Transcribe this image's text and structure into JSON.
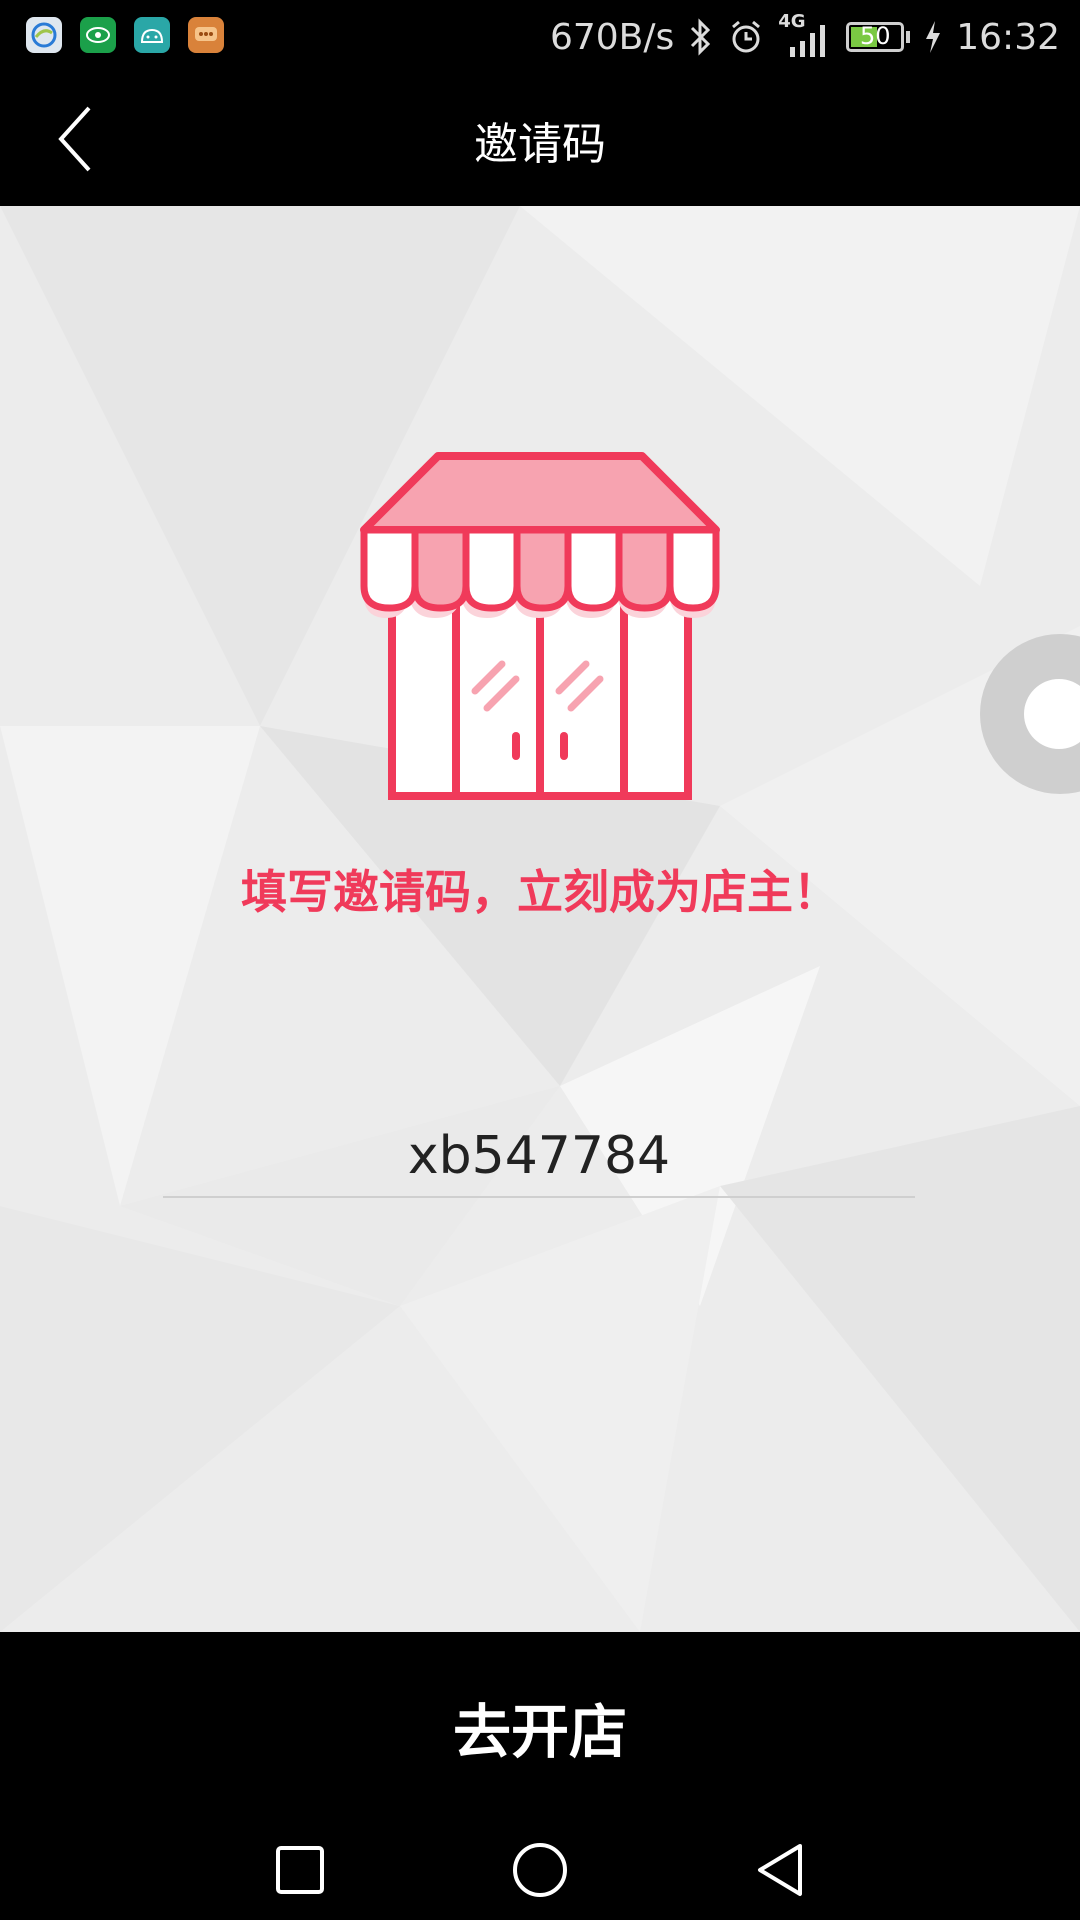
{
  "status_bar": {
    "net_speed": "670B/s",
    "network": "4G",
    "battery": "50",
    "time": "16:32",
    "icons": [
      "china-mobile-icon",
      "eye-app-icon",
      "android-app-icon",
      "message-app-icon",
      "bluetooth-icon",
      "alarm-icon",
      "signal-icon",
      "battery-icon",
      "charging-icon"
    ]
  },
  "header": {
    "title": "邀请码",
    "back_icon": "back-arrow-icon"
  },
  "main": {
    "illustration": "shop-storefront-icon",
    "tagline": "填写邀请码，立刻成为店主！",
    "invite_code_value": "xb547784"
  },
  "actions": {
    "open_shop_label": "去开店"
  },
  "nav_bar": {
    "icons": [
      "recent-apps-icon",
      "home-icon",
      "back-icon"
    ]
  },
  "colors": {
    "accent": "#f03a5a",
    "awning_light": "#f7a3b0",
    "background": "#ededed",
    "bars": "#000000"
  }
}
